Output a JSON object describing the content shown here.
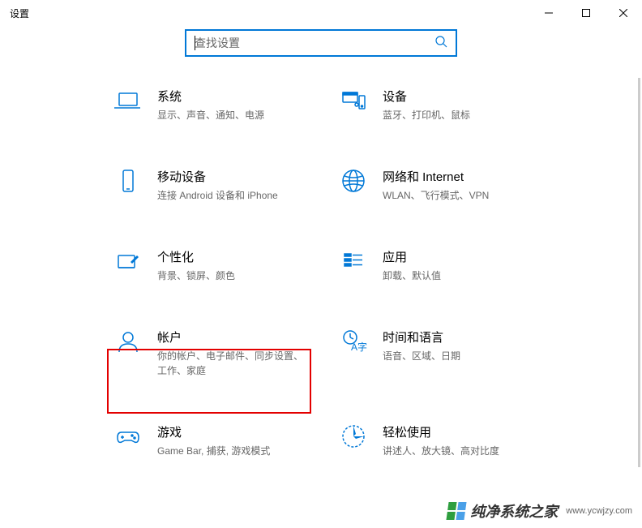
{
  "window": {
    "title": "设置"
  },
  "search": {
    "placeholder": "查找设置"
  },
  "categories": [
    {
      "id": "system",
      "title": "系统",
      "desc": "显示、声音、通知、电源",
      "icon": "laptop-icon"
    },
    {
      "id": "devices",
      "title": "设备",
      "desc": "蓝牙、打印机、鼠标",
      "icon": "devices-icon"
    },
    {
      "id": "phone",
      "title": "移动设备",
      "desc": "连接 Android 设备和 iPhone",
      "icon": "phone-icon"
    },
    {
      "id": "network",
      "title": "网络和 Internet",
      "desc": "WLAN、飞行模式、VPN",
      "icon": "globe-icon"
    },
    {
      "id": "personalization",
      "title": "个性化",
      "desc": "背景、锁屏、颜色",
      "icon": "personalize-icon"
    },
    {
      "id": "apps",
      "title": "应用",
      "desc": "卸载、默认值",
      "icon": "apps-icon"
    },
    {
      "id": "accounts",
      "title": "帐户",
      "desc": "你的帐户、电子邮件、同步设置、工作、家庭",
      "icon": "person-icon"
    },
    {
      "id": "time",
      "title": "时间和语言",
      "desc": "语音、区域、日期",
      "icon": "time-lang-icon"
    },
    {
      "id": "gaming",
      "title": "游戏",
      "desc": "Game Bar, 捕获, 游戏模式",
      "icon": "gaming-icon"
    },
    {
      "id": "ease",
      "title": "轻松使用",
      "desc": "讲述人、放大镜、高对比度",
      "icon": "ease-icon"
    }
  ],
  "watermark": {
    "text": "纯净系统之家",
    "url": "www.ycwjzy.com"
  }
}
